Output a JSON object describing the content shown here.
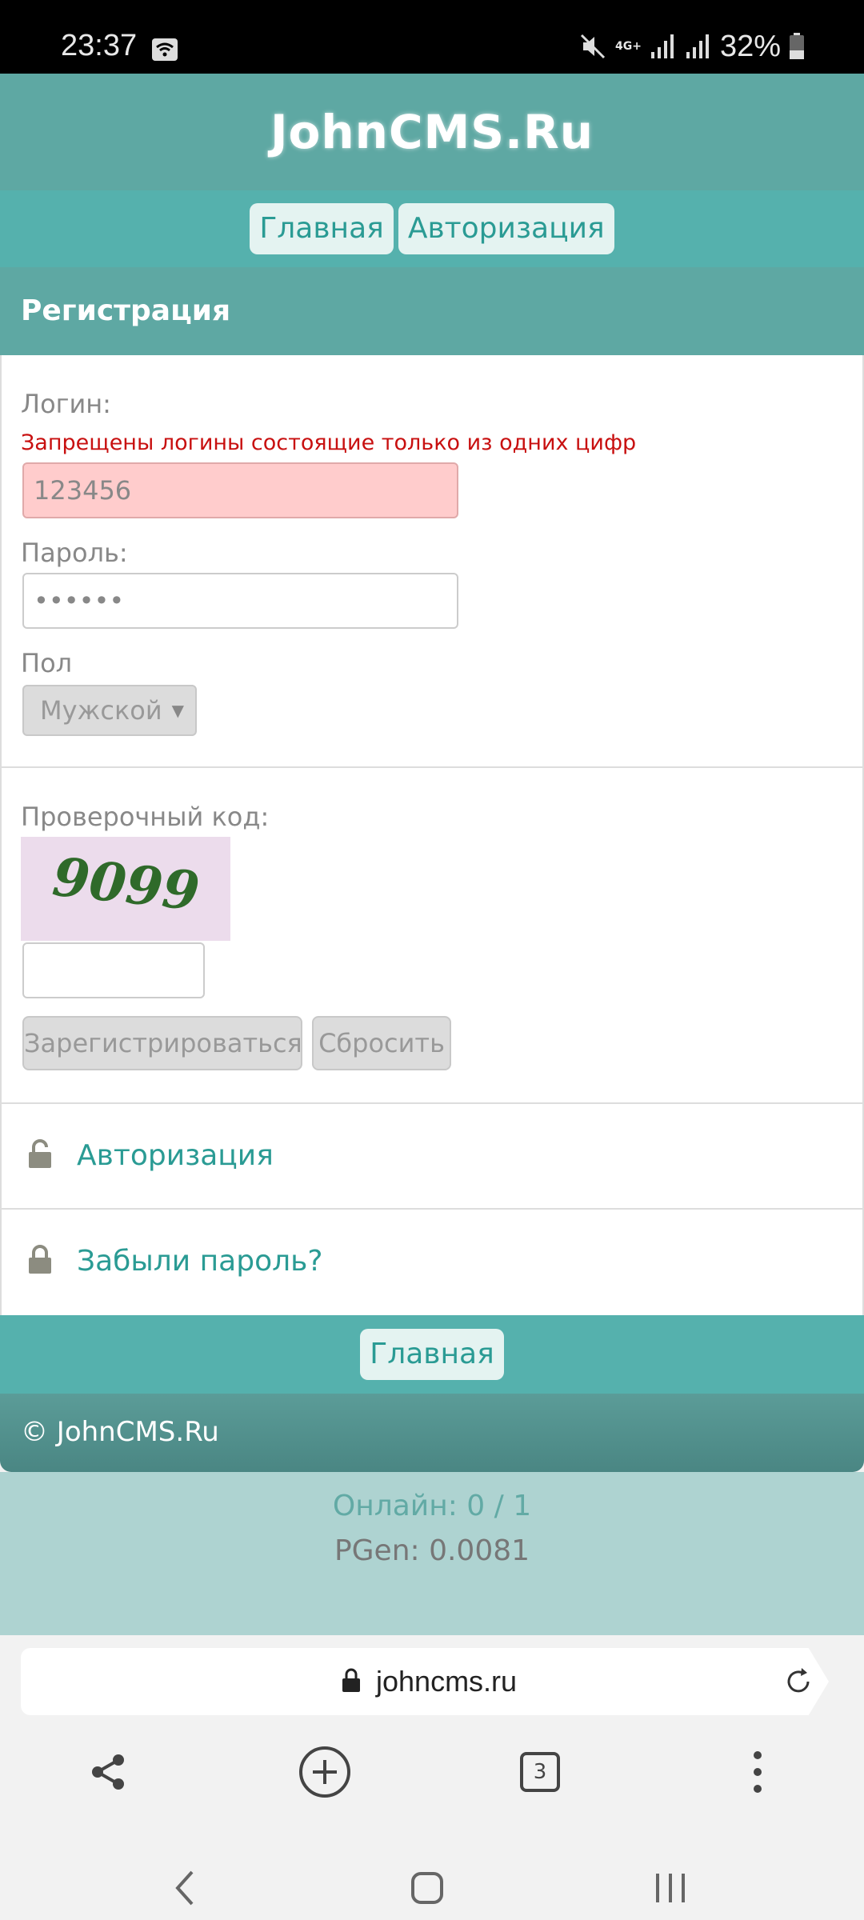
{
  "status_bar": {
    "time": "23:37",
    "network": "4G+",
    "battery": "32%",
    "icons": [
      "wifi-icon",
      "mute-icon",
      "signal-icon",
      "battery-icon"
    ]
  },
  "site": {
    "logo": "JohnCMS.Ru",
    "top_nav": [
      "Главная",
      "Авторизация"
    ],
    "page_title": "Регистрация"
  },
  "form": {
    "login_label": "Логин:",
    "login_error": "Запрещены логины состоящие только из одних цифр",
    "login_value": "123456",
    "password_label": "Пароль:",
    "password_value": "••••••",
    "gender_label": "Пол",
    "gender_selected": "Мужской",
    "captcha_label": "Проверочный код:",
    "captcha_code": "9099",
    "captcha_input_value": "",
    "submit_label": "Зарегистрироваться",
    "reset_label": "Сбросить"
  },
  "links": {
    "login_link": "Авторизация",
    "forgot_link": "Забыли пароль?"
  },
  "bottom_nav": {
    "home": "Главная"
  },
  "footer": {
    "copyright": "© JohnCMS.Ru",
    "online": "Онлайн: 0 / 1",
    "pgen": "PGen: 0.0081"
  },
  "browser": {
    "url": "johncms.ru",
    "tab_count": "3"
  },
  "colors": {
    "header": "#5ea8a3",
    "nav": "#55b1ad",
    "link": "#2a9b94",
    "error": "#c81010",
    "error_field": "#ffcccc"
  }
}
